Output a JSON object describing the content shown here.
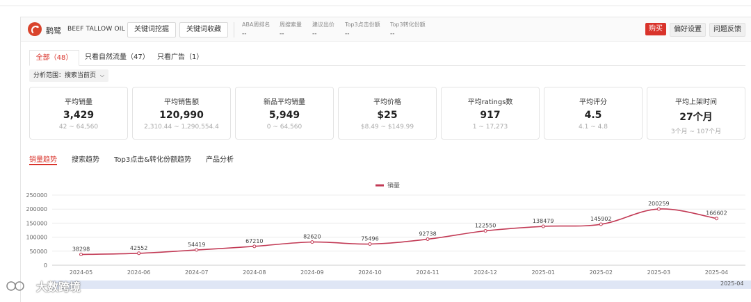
{
  "header": {
    "brand": "鹳鹭",
    "product": "BEEF TALLOW OIL",
    "buttons": [
      "关键词挖掘",
      "关键词收藏"
    ],
    "metrics": [
      {
        "label": "ABA周排名",
        "value": "--"
      },
      {
        "label": "周搜索量",
        "value": "--"
      },
      {
        "label": "建议出价",
        "value": "--"
      },
      {
        "label": "Top3点击份额",
        "value": "--"
      },
      {
        "label": "Top3转化份额",
        "value": "--"
      }
    ],
    "buy_label": "购买",
    "pref_label": "偏好设置",
    "feedback_label": "问题反馈"
  },
  "tabs": [
    "全部（48）",
    "只看自然流量（47）",
    "只看广告（1）"
  ],
  "scope": {
    "label": "分析范围：",
    "value": "搜索当前页"
  },
  "cards": [
    {
      "title": "平均销量",
      "value": "3,429",
      "range": "42 ~ 64,560"
    },
    {
      "title": "平均销售额",
      "value": "120,990",
      "range": "2,310.44 ~ 1,290,554.4"
    },
    {
      "title": "新品平均销量",
      "value": "5,949",
      "range": "0 ~ 64,560"
    },
    {
      "title": "平均价格",
      "value": "$25",
      "range": "$8.49 ~ $149.99"
    },
    {
      "title": "平均ratings数",
      "value": "917",
      "range": "1 ~ 17,273"
    },
    {
      "title": "平均评分",
      "value": "4.5",
      "range": "4.1 ~ 4.8"
    },
    {
      "title": "平均上架时间",
      "value": "27个月",
      "range": "3个月 ~ 107个月"
    }
  ],
  "chart_tabs": [
    "销量趋势",
    "搜索趋势",
    "Top3点击&转化份额趋势",
    "产品分析"
  ],
  "chart_data": {
    "type": "line",
    "legend": "销量",
    "legend_position": "top-center",
    "categories": [
      "2024-05",
      "2024-06",
      "2024-07",
      "2024-08",
      "2024-09",
      "2024-10",
      "2024-11",
      "2024-12",
      "2025-01",
      "2025-02",
      "2025-03",
      "2025-04"
    ],
    "series": [
      {
        "name": "销量",
        "values": [
          38298,
          42552,
          54419,
          67210,
          82620,
          75496,
          92738,
          122550,
          138479,
          145902,
          200259,
          166602
        ]
      }
    ],
    "ylim": [
      0,
      250000
    ],
    "yticks": [
      "0",
      "50000",
      "100000",
      "150000",
      "200000",
      "250000"
    ],
    "grid": true,
    "color": "#c23a55",
    "zoom_label": "2025-04"
  },
  "watermark": "大数跨境"
}
